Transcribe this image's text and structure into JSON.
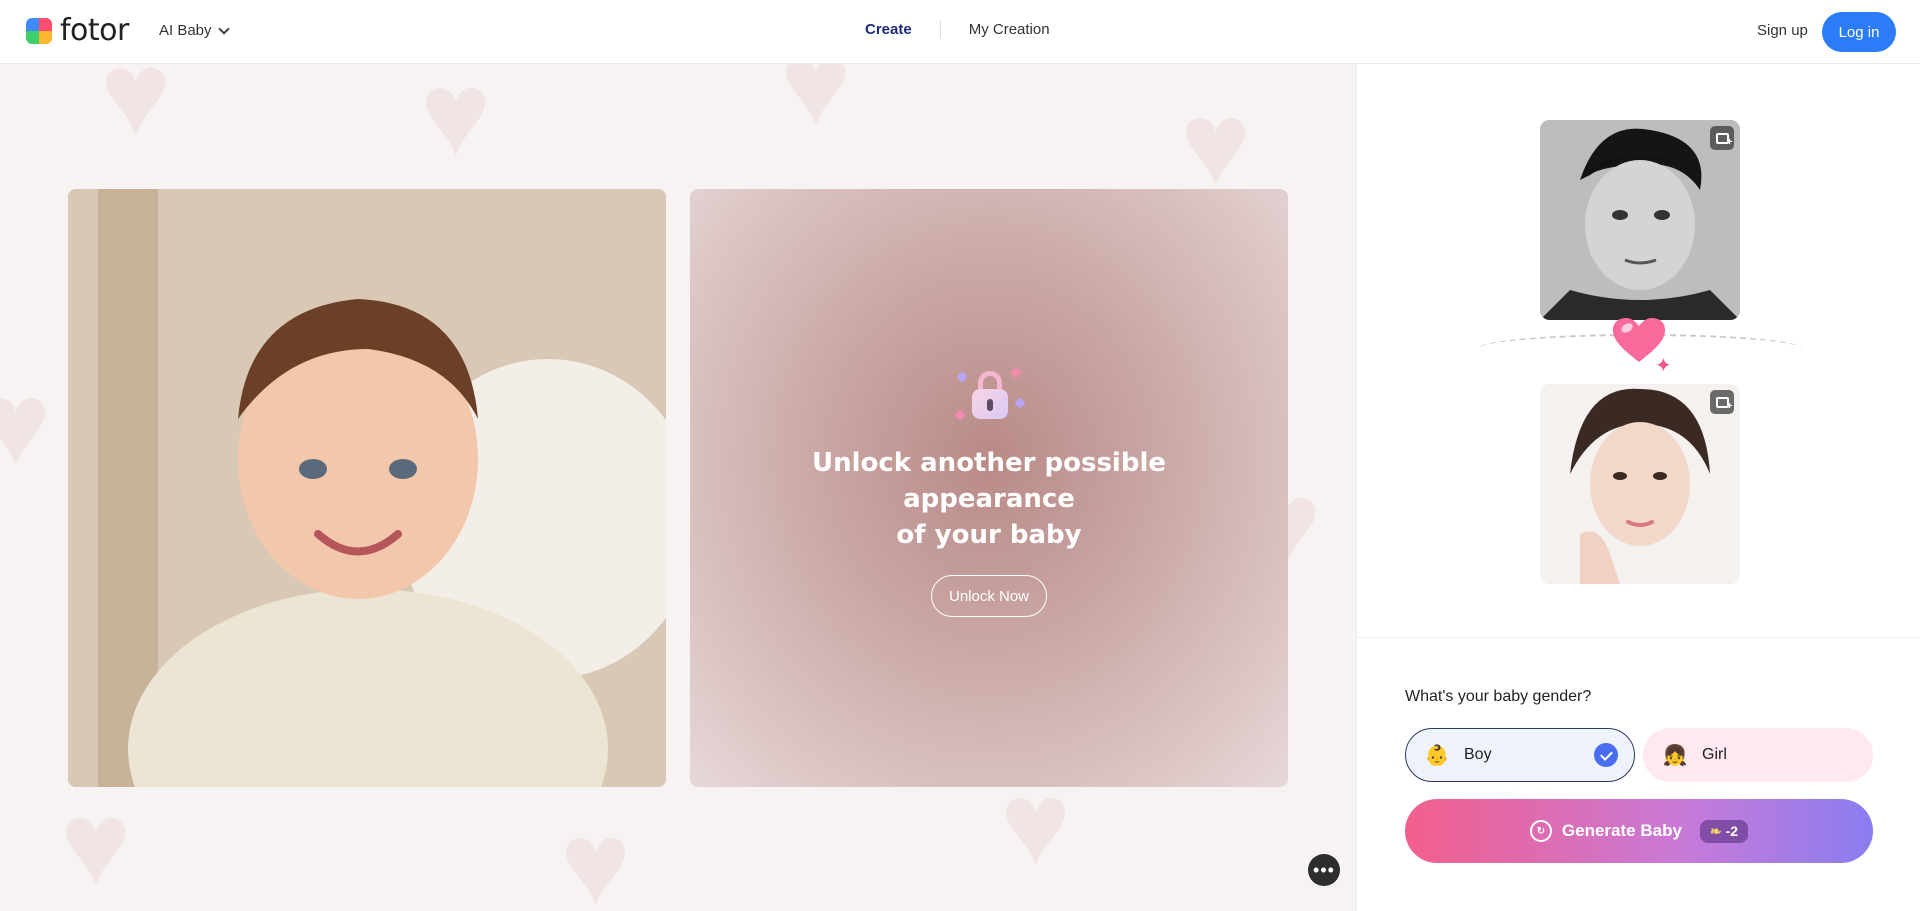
{
  "header": {
    "brand": "fotor",
    "product_menu": "AI Baby",
    "nav": [
      {
        "label": "Create",
        "active": true
      },
      {
        "label": "My Creation",
        "active": false
      }
    ],
    "signup_label": "Sign up",
    "login_label": "Log in"
  },
  "main": {
    "unlock_title_line1": "Unlock another possible appearance",
    "unlock_title_line2": "of your baby",
    "unlock_button": "Unlock Now",
    "more_button": "•••"
  },
  "panel": {
    "gender_question": "What's your baby gender?",
    "gender_options": [
      {
        "label": "Boy",
        "selected": true,
        "emoji": "👶"
      },
      {
        "label": "Girl",
        "selected": false,
        "emoji": "👧"
      }
    ],
    "generate_label": "Generate Baby",
    "credit_cost": "-2"
  },
  "colors": {
    "accent_blue": "#2b7cf6",
    "nav_active": "#1f2a7a",
    "generate_gradient_start": "#f25f8c",
    "generate_gradient_end": "#8a7df0",
    "check_blue": "#4b6ef0"
  }
}
